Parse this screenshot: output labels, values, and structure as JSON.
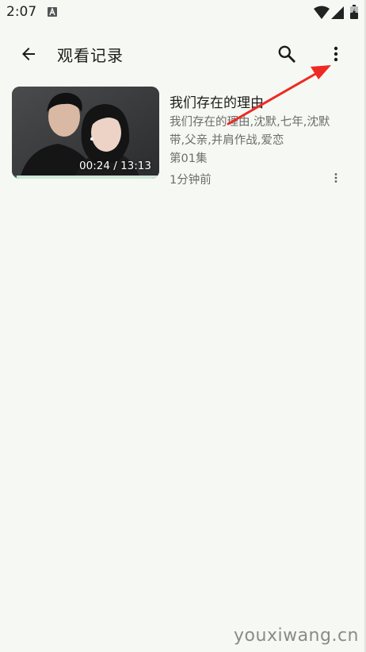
{
  "status_bar": {
    "time": "2:07",
    "icons": [
      "wifi-icon",
      "signal-icon",
      "battery-charging-icon"
    ]
  },
  "app_bar": {
    "title": "观看记录",
    "icons": [
      "arrow-back-icon",
      "search-icon",
      "more-vert-icon"
    ]
  },
  "history": {
    "items": [
      {
        "title": "我们存在的理由",
        "description": "我们存在的理由,沈默,七年,沈默带,父亲,并肩作战,爱恋",
        "episode": "第01集",
        "watched_time": "1分钟前",
        "duration_text": "00:24 / 13:13",
        "progress_fraction": 0.03
      }
    ]
  },
  "watermark": "youxiwang.cn",
  "colors": {
    "background": "#f6f9f3",
    "progress": "#1f7a4d",
    "progress_track": "#cfe8d8",
    "annotation_arrow": "#ee2a24"
  }
}
